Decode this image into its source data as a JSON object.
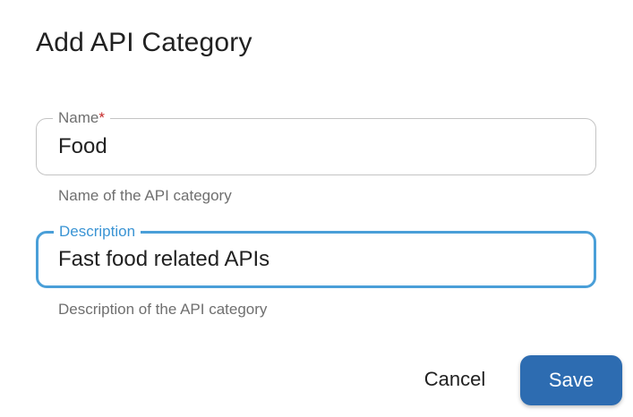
{
  "dialog": {
    "title": "Add API Category"
  },
  "name_field": {
    "label": "Name",
    "required_marker": "*",
    "value": "Food",
    "helper": "Name of the API category"
  },
  "description_field": {
    "label": "Description",
    "value": "Fast food related APIs",
    "helper": "Description of the API category"
  },
  "actions": {
    "cancel_label": "Cancel",
    "save_label": "Save"
  },
  "colors": {
    "focus_border": "#4a9fd8",
    "primary_button": "#2d6cb1",
    "required": "#c62828"
  }
}
